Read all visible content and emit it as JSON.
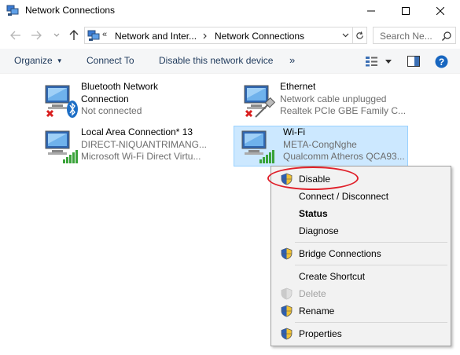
{
  "window": {
    "title": "Network Connections"
  },
  "nav": {
    "breadcrumb_overflow": "«",
    "crumbs": [
      "Network and Inter...",
      "Network Connections"
    ],
    "search_placeholder": "Search Ne..."
  },
  "toolbar": {
    "organize": "Organize",
    "connect_to": "Connect To",
    "disable_device": "Disable this network device",
    "more": "»"
  },
  "items": [
    {
      "name": "Bluetooth Network",
      "line2": "Connection",
      "line3": "Not connected",
      "status": "disconnected",
      "badge": "bluetooth-icon"
    },
    {
      "name": "Ethernet",
      "line2": "Network cable unplugged",
      "line3": "Realtek PCIe GBE Family C...",
      "status": "disconnected",
      "badge": "ethernet-cable-icon"
    },
    {
      "name": "Local Area Connection* 13",
      "line2": "DIRECT-NIQUANTRIMANG...",
      "line3": "Microsoft Wi-Fi Direct Virtu...",
      "status": "connected",
      "badge": "signal-bars-icon"
    },
    {
      "name": "Wi-Fi",
      "line2": "META-CongNghe",
      "line3": "Qualcomm Atheros QCA93...",
      "status": "connected",
      "badge": "signal-bars-icon",
      "selected": true
    }
  ],
  "context_menu": {
    "disable": "Disable",
    "connect_disconnect": "Connect / Disconnect",
    "status": "Status",
    "diagnose": "Diagnose",
    "bridge": "Bridge Connections",
    "create_shortcut": "Create Shortcut",
    "delete": "Delete",
    "rename": "Rename",
    "properties": "Properties"
  },
  "colors": {
    "selection_bg": "#cce8ff",
    "selection_border": "#99d1ff",
    "highlight_ring": "#e0202a",
    "toolbar_text": "#1e395b"
  }
}
